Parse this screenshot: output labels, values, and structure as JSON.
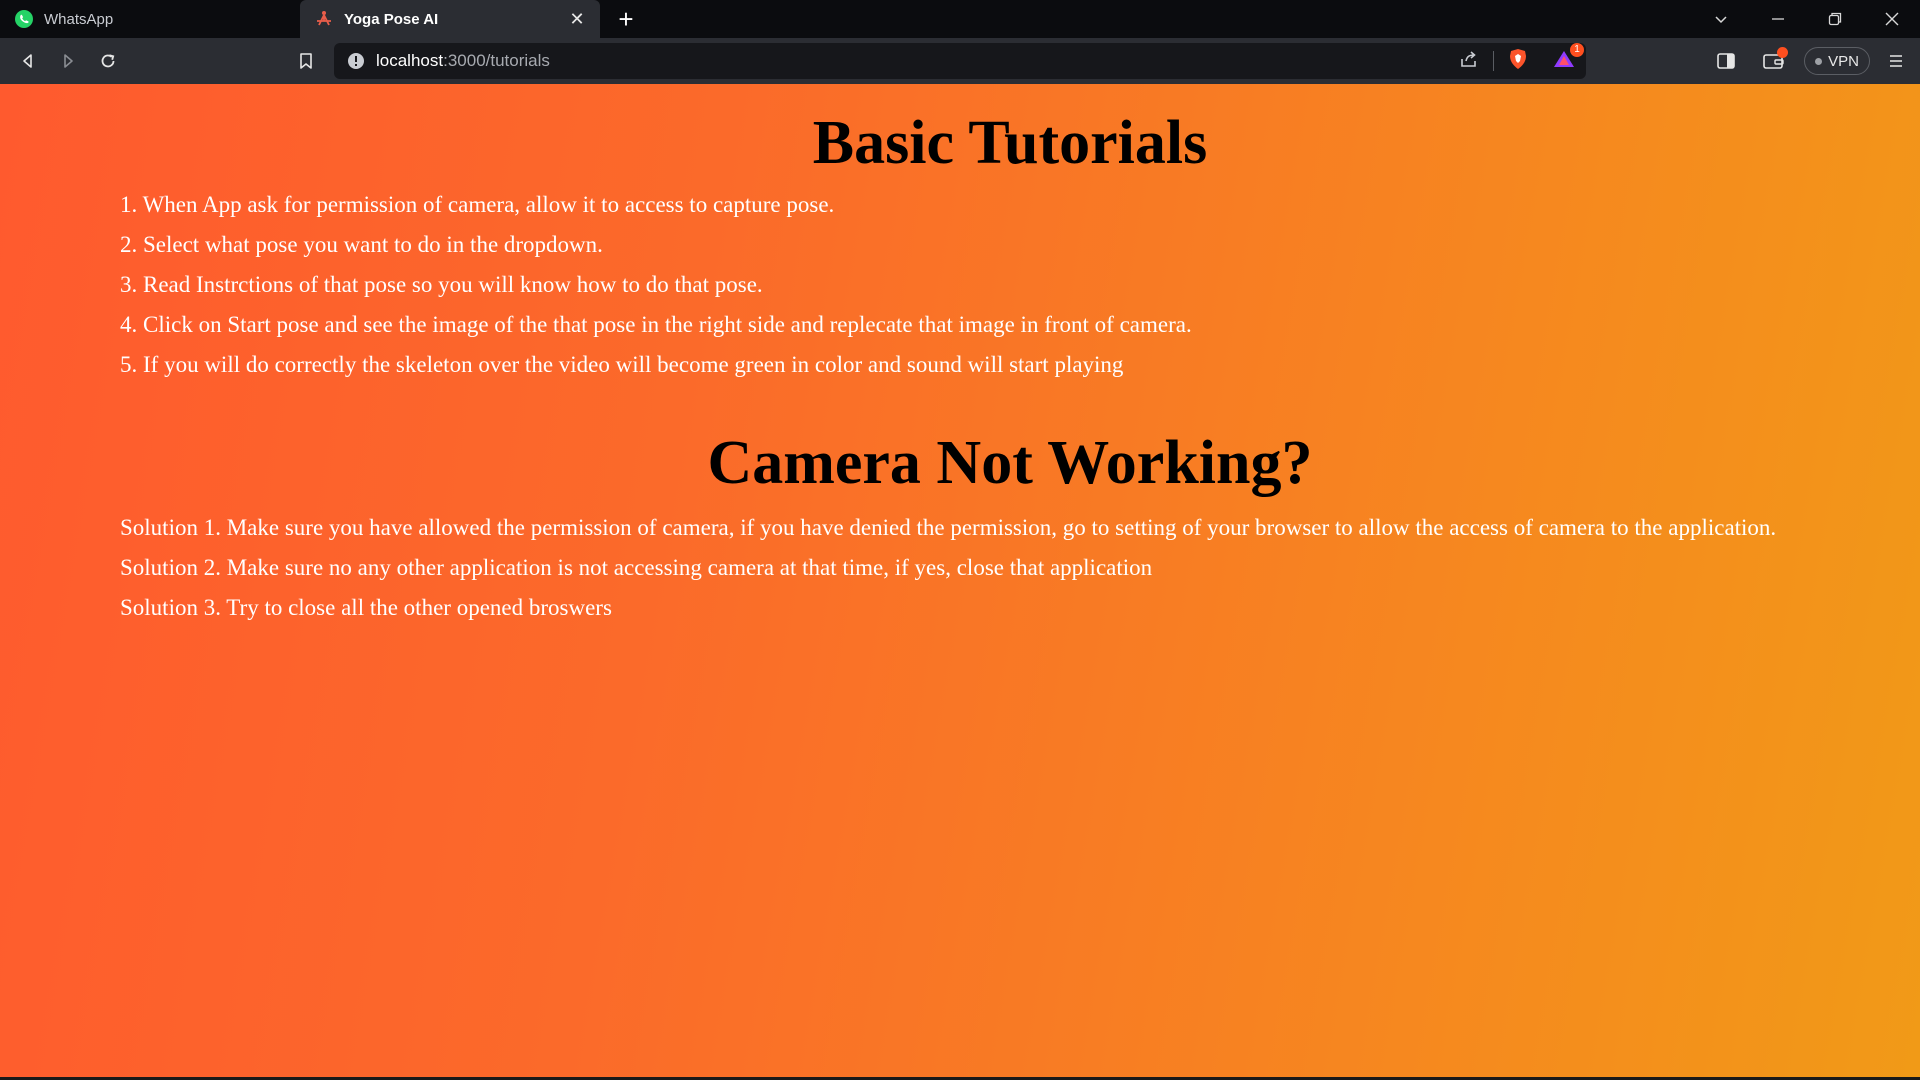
{
  "browser": {
    "tabs": [
      {
        "title": "WhatsApp",
        "favicon": "whatsapp-icon",
        "active": false
      },
      {
        "title": "Yoga Pose AI",
        "favicon": "yoga-pose-icon",
        "active": true
      }
    ],
    "address": {
      "host": "localhost",
      "path": ":3000/tutorials"
    },
    "vpn_label": "VPN",
    "rewards_badge": "1"
  },
  "page": {
    "tutorials_title": "Basic Tutorials",
    "steps": [
      "1. When App ask for permission of camera, allow it to access to capture pose.",
      "2. Select what pose you want to do in the dropdown.",
      "3. Read Instrctions of that pose so you will know how to do that pose.",
      "4. Click on Start pose and see the image of the that pose in the right side and replecate that image in front of camera.",
      "5. If you will do correctly the skeleton over the video will become green in color and sound will start playing"
    ],
    "camera_title": "Camera Not Working?",
    "solutions": [
      "Solution 1. Make sure you have allowed the permission of camera, if you have denied the permission, go to setting of your browser to allow the access of camera to the application.",
      "Solution 2. Make sure no any other application is not accessing camera at that time, if yes, close that application",
      "Solution 3. Try to close all the other opened broswers"
    ]
  },
  "colors": {
    "gradient_start": "#ff5a2e",
    "gradient_end": "#f19a17",
    "heading": "#000000",
    "body_text": "#ffffff"
  }
}
